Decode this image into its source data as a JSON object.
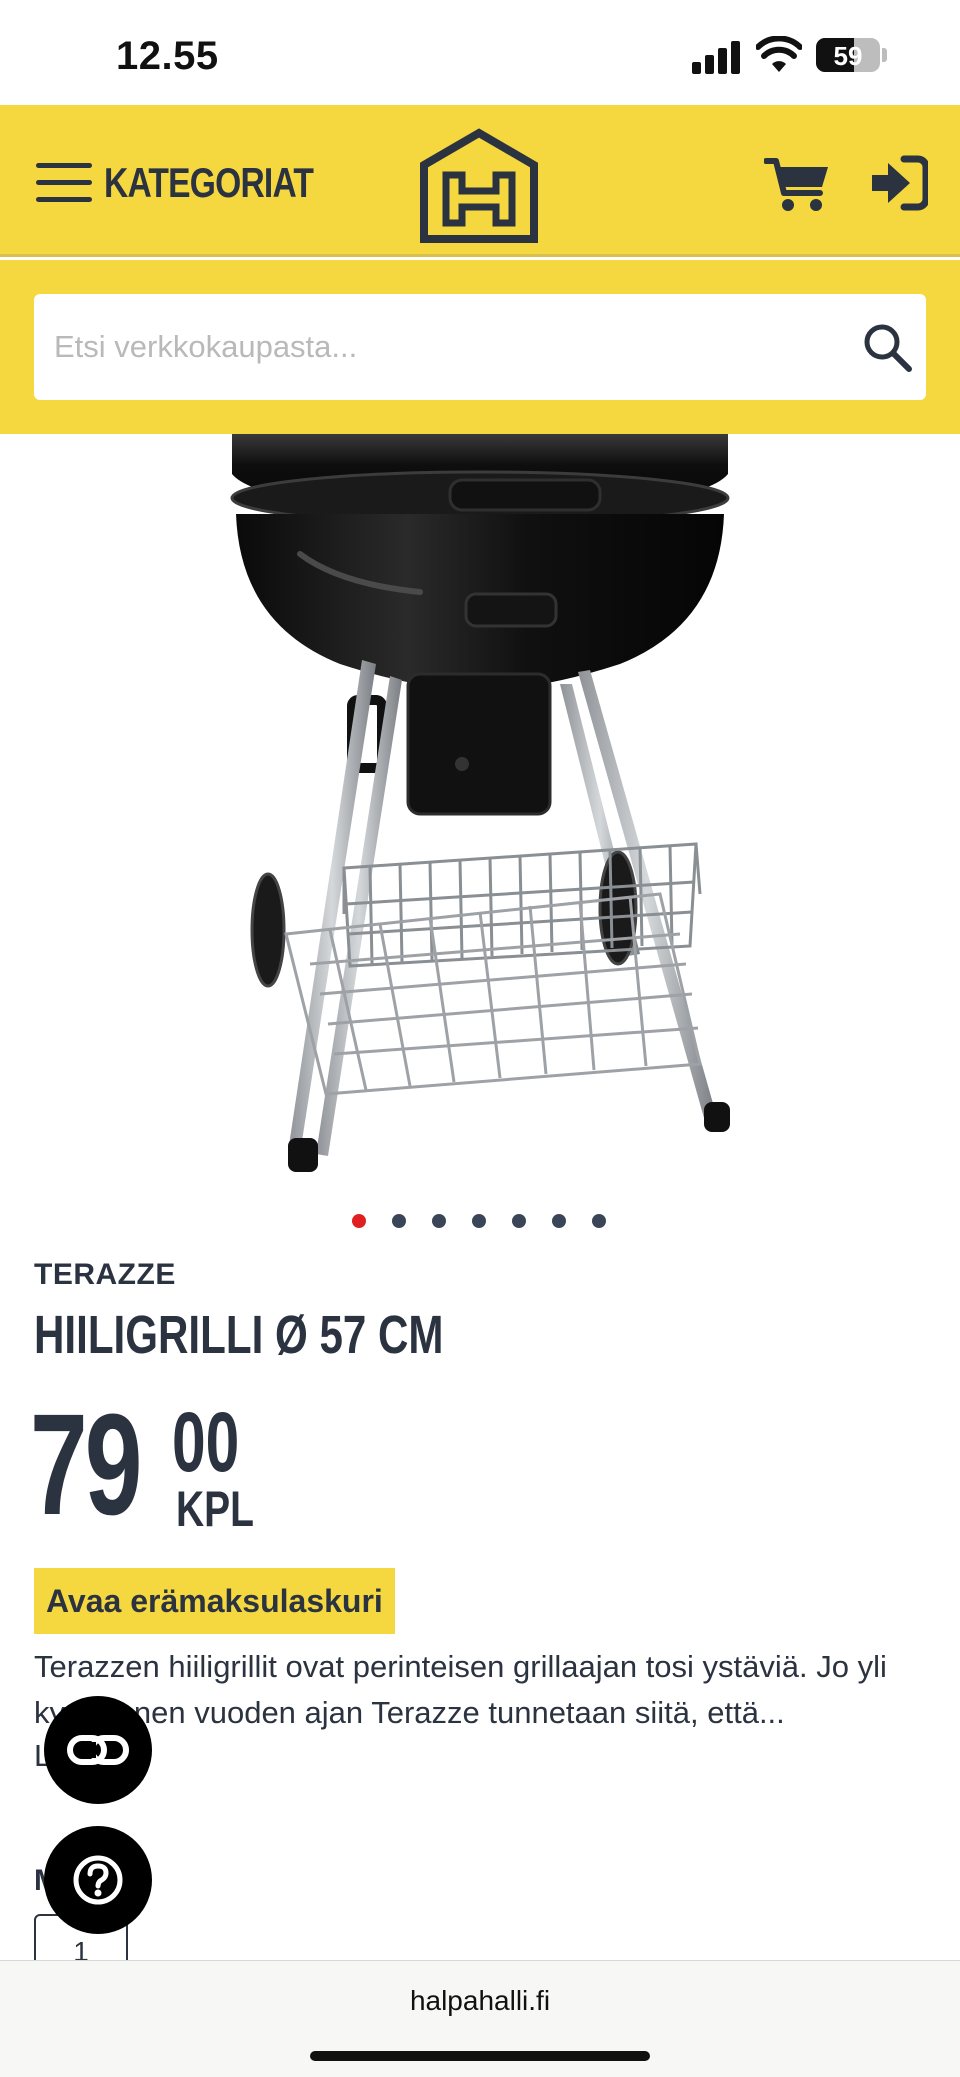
{
  "status_bar": {
    "time": "12.55",
    "battery_level": "59",
    "battery_fraction": 0.59
  },
  "header": {
    "menu_label": "KATEGORIAT",
    "logo_icon": "halpahalli-house-logo",
    "cart_icon": "shopping-cart-icon",
    "login_icon": "sign-in-icon",
    "background_color": "#f5d73f"
  },
  "search": {
    "placeholder": "Etsi verkkokaupasta...",
    "value": "",
    "icon": "search-icon"
  },
  "product": {
    "image_alt": "charcoal-kettle-grill-photo",
    "carousel": {
      "count": 7,
      "active_index": 0
    },
    "brand": "TERAZZE",
    "title": "HIILIGRILLI Ø 57 CM",
    "price_integer": "79",
    "price_decimals": "00",
    "price_unit": "KPL",
    "installment_button": "Avaa erämaksulaskuri",
    "description": "Terazzen hiiligrillit ovat perinteisen grillaajan tosi ystäviä. Jo yli kymmenen vuoden ajan Terazze tunnetaan siitä, että...",
    "read_more": "L",
    "quantity_label": "M",
    "quantity_value": "1"
  },
  "floating_buttons": {
    "link_icon": "link-icon",
    "help_icon": "help-circle-icon"
  },
  "browser": {
    "url": "halpahalli.fi"
  },
  "colors": {
    "brand_yellow": "#f5d73f",
    "text_dark": "#2b3340",
    "active_dot": "#e02020"
  }
}
